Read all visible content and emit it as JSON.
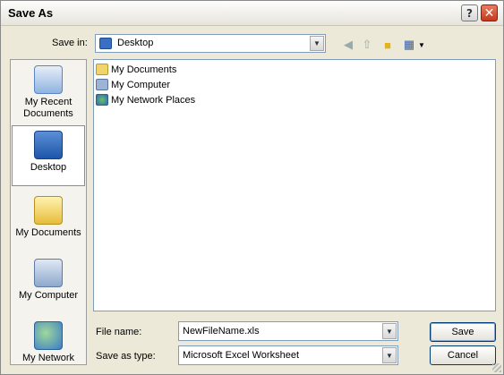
{
  "window": {
    "title": "Save As"
  },
  "titlebar": {
    "help_icon": "help-icon",
    "close_icon": "close-icon"
  },
  "savein": {
    "label": "Save in:",
    "value": "Desktop"
  },
  "toolbar": {
    "icons": [
      "back-icon",
      "up-folder-icon",
      "new-folder-icon",
      "views-icon"
    ]
  },
  "places": [
    {
      "label": "My Recent Documents",
      "icon": "recent-documents-icon"
    },
    {
      "label": "Desktop",
      "icon": "desktop-icon"
    },
    {
      "label": "My Documents",
      "icon": "my-documents-icon"
    },
    {
      "label": "My Computer",
      "icon": "my-computer-icon"
    },
    {
      "label": "My Network",
      "icon": "my-network-icon"
    }
  ],
  "files": [
    {
      "label": "My Documents",
      "icon": "folder-icon"
    },
    {
      "label": "My Computer",
      "icon": "computer-icon"
    },
    {
      "label": "My Network Places",
      "icon": "network-places-icon"
    }
  ],
  "filename": {
    "label": "File name:",
    "value": "NewFileName.xls"
  },
  "savetype": {
    "label": "Save as type:",
    "value": "Microsoft Excel Worksheet"
  },
  "buttons": {
    "save": "Save",
    "cancel": "Cancel"
  },
  "colors": {
    "accent": "#0a246a",
    "close": "#c4391c",
    "panel": "#ece9d8"
  }
}
